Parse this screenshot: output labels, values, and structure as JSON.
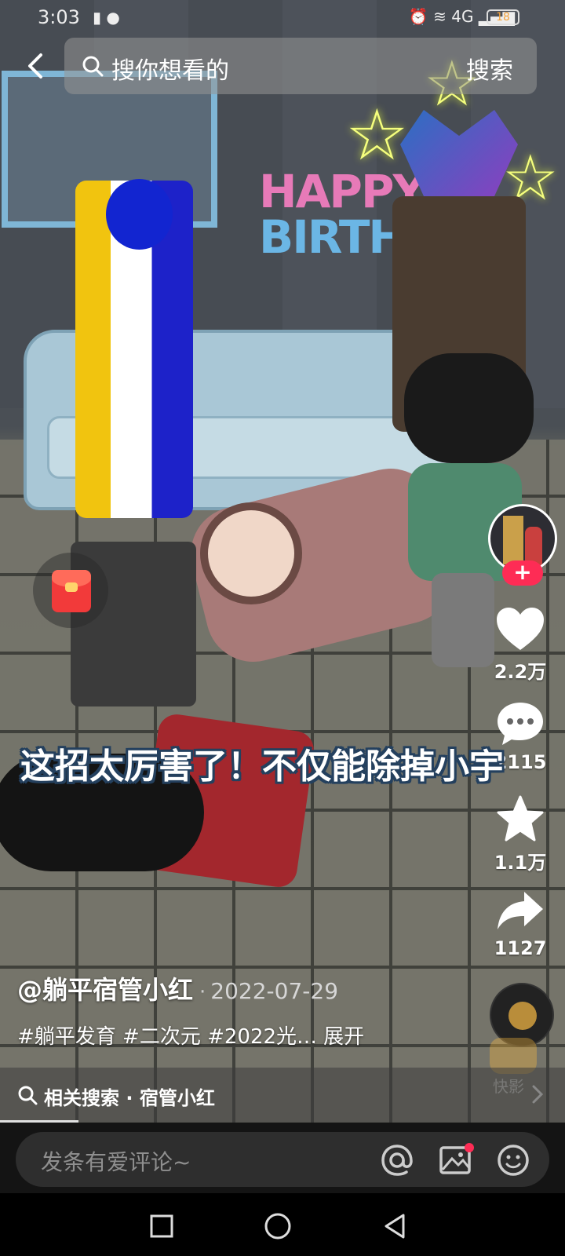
{
  "status_bar": {
    "time": "3:03",
    "network": "4G",
    "battery_level": "18"
  },
  "search": {
    "placeholder": "搜你想看的",
    "button_label": "搜索"
  },
  "video": {
    "happy_line1": "HAPPY",
    "happy_line2": "BIRTHD",
    "subtitle": "这招太厉害了！不仅能除掉小宇"
  },
  "right_rail": {
    "likes": "2.2万",
    "comments": "2115",
    "favorites": "1.1万",
    "shares": "1127",
    "follow_label": "+"
  },
  "post": {
    "author": "@躺平宿管小红",
    "separator": "·",
    "date": "2022-07-29",
    "description": "#躺平发育 #二次元 #2022光…",
    "expand_label": "展开"
  },
  "watermark": {
    "label": "快影"
  },
  "related_search": {
    "label": "相关搜索 · 宿管小红"
  },
  "comment_bar": {
    "placeholder": "发条有爱评论~"
  },
  "colors": {
    "accent": "#fe2c55",
    "subtitle_outline": "#24405e",
    "background": "#000000"
  },
  "icons": [
    "back-arrow-icon",
    "search-icon",
    "heart-icon",
    "comment-icon",
    "star-icon",
    "share-icon",
    "red-packet-icon",
    "at-icon",
    "image-icon",
    "emoji-icon",
    "chevron-right-icon",
    "square-nav-icon",
    "circle-nav-icon",
    "triangle-back-nav-icon"
  ]
}
